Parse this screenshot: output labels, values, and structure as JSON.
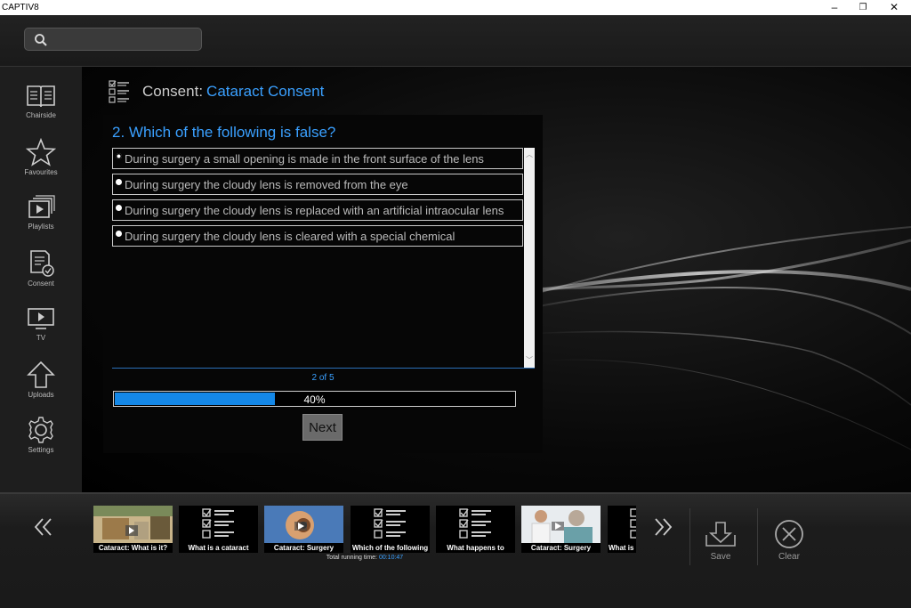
{
  "window": {
    "title": "CAPTIV8",
    "minimize": "–",
    "maximize": "❐",
    "close": "✕"
  },
  "search": {
    "placeholder": "",
    "value": ""
  },
  "sidebar": {
    "items": [
      {
        "label": "Chairside",
        "icon": "book-icon"
      },
      {
        "label": "Favourites",
        "icon": "star-icon"
      },
      {
        "label": "Playlists",
        "icon": "playlist-icon"
      },
      {
        "label": "Consent",
        "icon": "consent-icon"
      },
      {
        "label": "TV",
        "icon": "tv-icon"
      },
      {
        "label": "Uploads",
        "icon": "upload-icon"
      },
      {
        "label": "Settings",
        "icon": "gear-icon"
      }
    ]
  },
  "header": {
    "prefix": "Consent:",
    "name": "Cataract Consent",
    "icon": "checklist-icon"
  },
  "quiz": {
    "question": "2. Which of the following is false?",
    "answers": [
      "During surgery a small opening is made in the front surface of the lens",
      "During surgery the cloudy lens is removed from the eye",
      "During surgery the cloudy lens is replaced with an artificial intraocular lens",
      "During surgery the cloudy lens is cleared with a special chemical"
    ],
    "selected_index": 0,
    "pager": "2 of 5",
    "progress_fraction": 0.4,
    "progress_label": "40%",
    "next_label": "Next"
  },
  "playlist": {
    "items": [
      {
        "caption": "Cataract: What is it?",
        "kind": "video"
      },
      {
        "caption": "What is a cataract",
        "kind": "quiz"
      },
      {
        "caption": "Cataract: Surgery",
        "kind": "video"
      },
      {
        "caption": "Which of the following",
        "kind": "quiz"
      },
      {
        "caption": "What happens to",
        "kind": "quiz"
      },
      {
        "caption": "Cataract: Surgery",
        "kind": "video"
      },
      {
        "caption": "What is",
        "kind": "quiz"
      }
    ],
    "running_label": "Total running time:",
    "running_time": "00:10:47"
  },
  "actions": {
    "save": "Save",
    "clear": "Clear"
  },
  "colors": {
    "accent": "#3aa0ff",
    "progress": "#1488e8"
  }
}
